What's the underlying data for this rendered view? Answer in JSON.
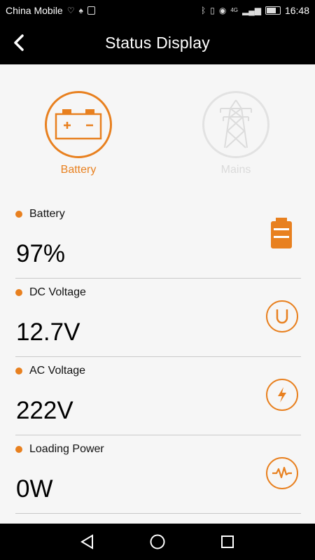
{
  "statusbar": {
    "carrier": "China Mobile",
    "time": "16:48",
    "network": "4G"
  },
  "appbar": {
    "title": "Status Display"
  },
  "modes": [
    {
      "label": "Battery",
      "active": true,
      "icon": "car-battery-icon"
    },
    {
      "label": "Mains",
      "active": false,
      "icon": "power-tower-icon"
    }
  ],
  "rows": [
    {
      "label": "Battery",
      "value": "97%",
      "icon": "battery-level-icon"
    },
    {
      "label": "DC Voltage",
      "value": "12.7V",
      "icon": "u-voltage-icon"
    },
    {
      "label": "AC Voltage",
      "value": "222V",
      "icon": "lightning-icon"
    },
    {
      "label": "Loading Power",
      "value": "0W",
      "icon": "pulse-wave-icon"
    }
  ],
  "colors": {
    "accent": "#e8801f",
    "inactive": "#e2e2e2",
    "background": "#f6f6f6",
    "bar": "#000000"
  },
  "navbar": {
    "buttons": [
      "back-triangle-icon",
      "home-circle-icon",
      "recents-square-icon"
    ]
  }
}
